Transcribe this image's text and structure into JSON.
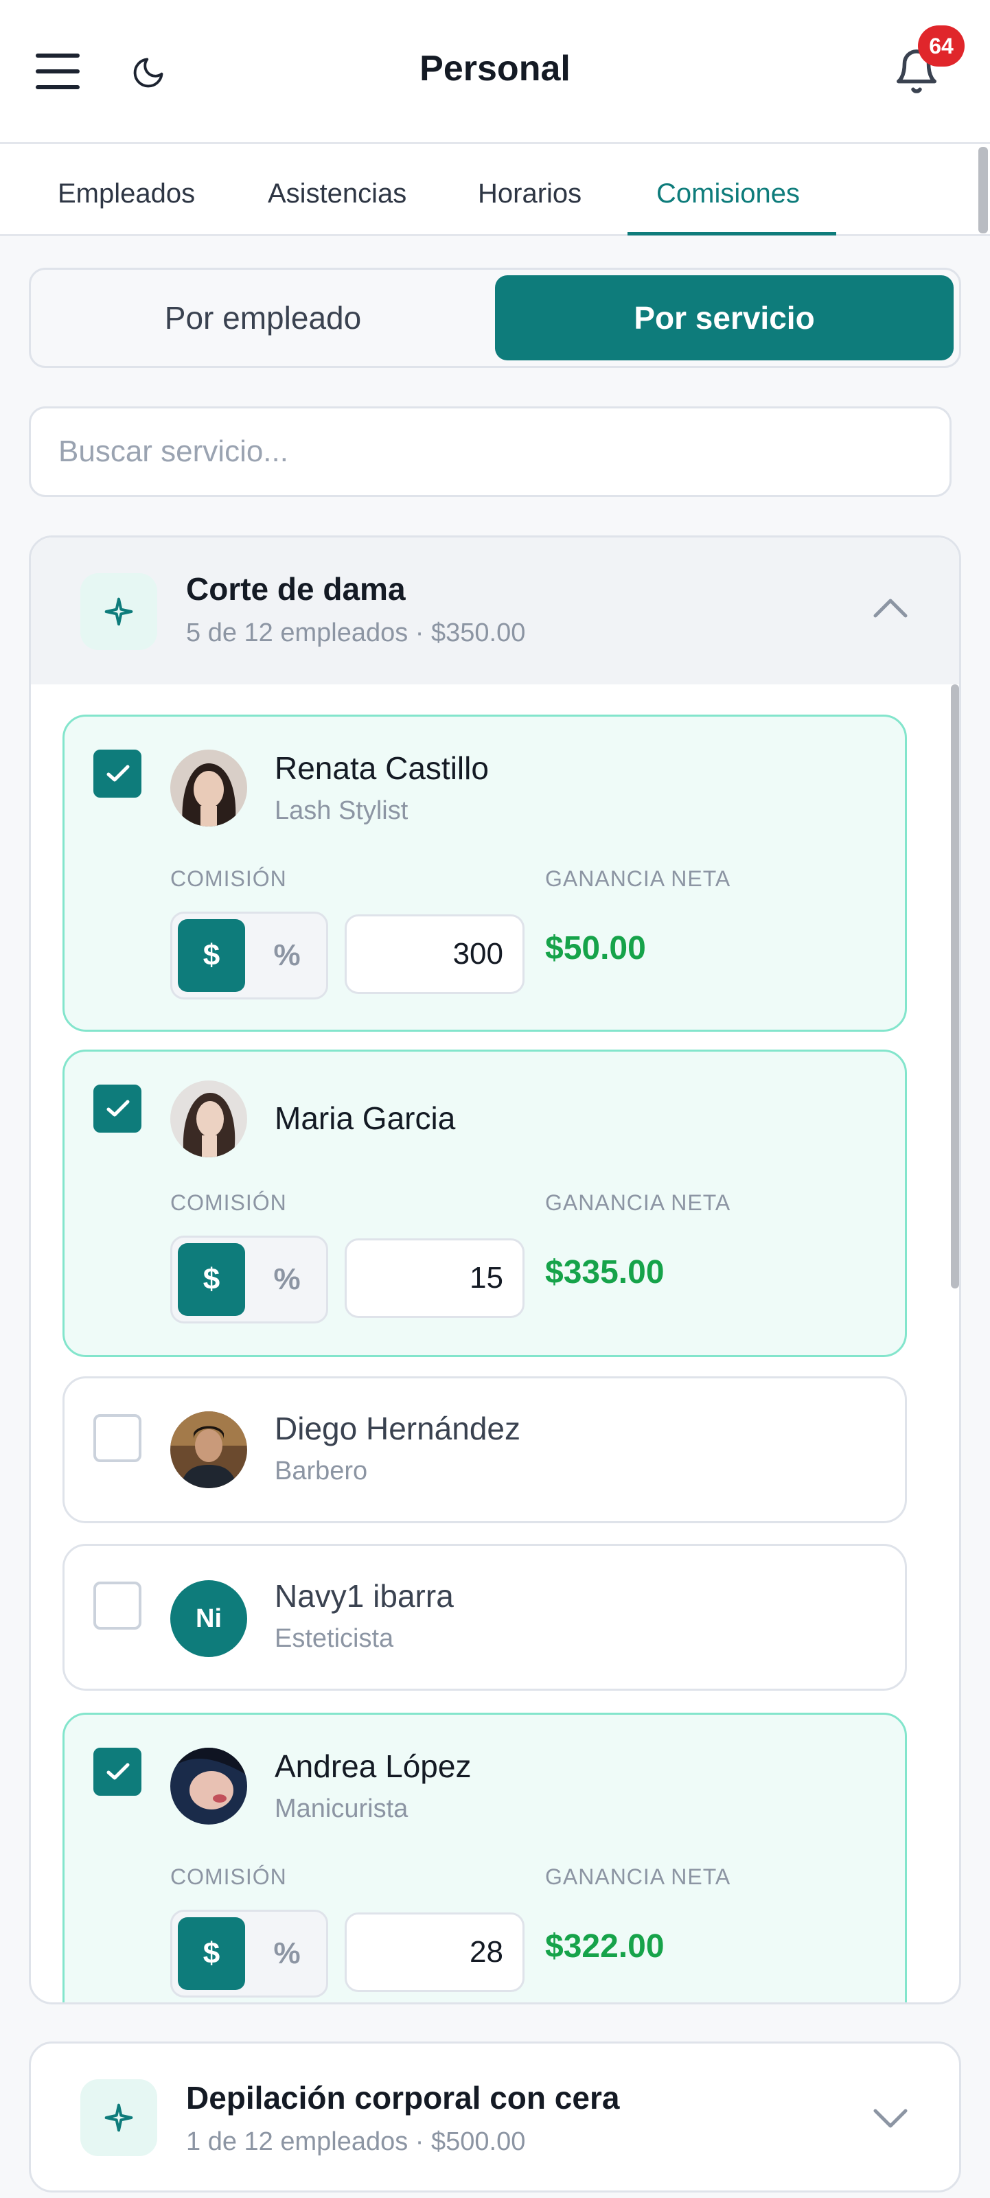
{
  "header": {
    "title": "Personal",
    "notifications": "64"
  },
  "tabs": [
    "Empleados",
    "Asistencias",
    "Horarios",
    "Comisiones"
  ],
  "segment": {
    "left": "Por empleado",
    "right": "Por servicio"
  },
  "search": {
    "placeholder": "Buscar servicio...",
    "value": ""
  },
  "services": [
    {
      "name": "Corte de dama",
      "meta": "5 de 12 empleados · $350.00",
      "employees": [
        {
          "name": "Renata Castillo",
          "role": "Lash Stylist",
          "checked": true,
          "commission_label": "COMISIÓN",
          "net_label": "GANANCIA NETA",
          "unit_dollar": "$",
          "unit_pct": "%",
          "value": "300",
          "net": "$50.00"
        },
        {
          "name": "Maria Garcia",
          "role": "",
          "checked": true,
          "commission_label": "COMISIÓN",
          "net_label": "GANANCIA NETA",
          "unit_dollar": "$",
          "unit_pct": "%",
          "value": "15",
          "net": "$335.00"
        },
        {
          "name": "Diego Hernández",
          "role": "Barbero",
          "checked": false
        },
        {
          "name": "Navy1 ibarra",
          "role": "Esteticista",
          "checked": false,
          "initials": "Ni"
        },
        {
          "name": "Andrea López",
          "role": "Manicurista",
          "checked": true,
          "commission_label": "COMISIÓN",
          "net_label": "GANANCIA NETA",
          "unit_dollar": "$",
          "unit_pct": "%",
          "value": "28",
          "net": "$322.00"
        }
      ]
    },
    {
      "name": "Depilación corporal con cera",
      "meta": "1 de 12 empleados · $500.00"
    }
  ],
  "colors": {
    "accent": "#0e7c7b",
    "net": "#16a34a",
    "badge": "#e0262b"
  }
}
